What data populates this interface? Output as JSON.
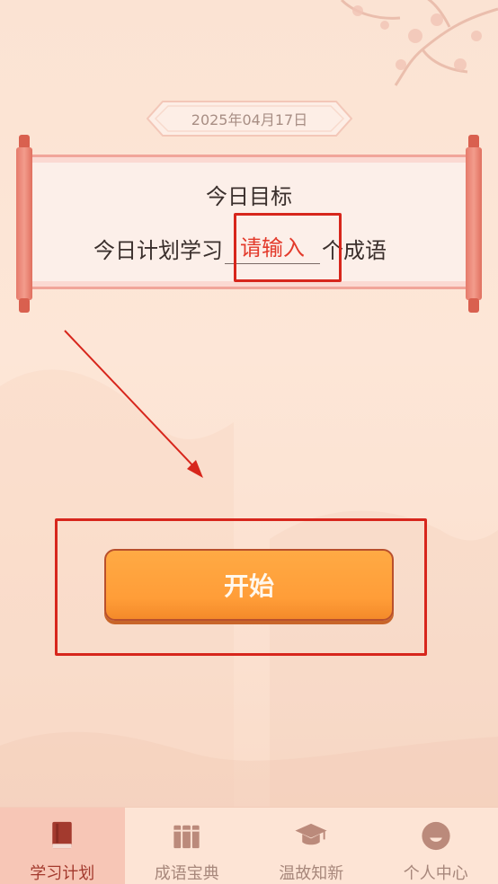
{
  "date": "2025年04月17日",
  "goal": {
    "title": "今日目标",
    "prefix": "今日计划学习",
    "input_placeholder": "请输入",
    "suffix": "个成语"
  },
  "start_button": "开始",
  "tabs": [
    {
      "label": "学习计划",
      "icon": "book-icon",
      "active": true
    },
    {
      "label": "成语宝典",
      "icon": "books-icon",
      "active": false
    },
    {
      "label": "温故知新",
      "icon": "graduation-cap-icon",
      "active": false
    },
    {
      "label": "个人中心",
      "icon": "profile-icon",
      "active": false
    }
  ],
  "colors": {
    "accent_red": "#d7261c",
    "button_orange": "#ff9d38",
    "active_tab": "#f7c6b6"
  }
}
